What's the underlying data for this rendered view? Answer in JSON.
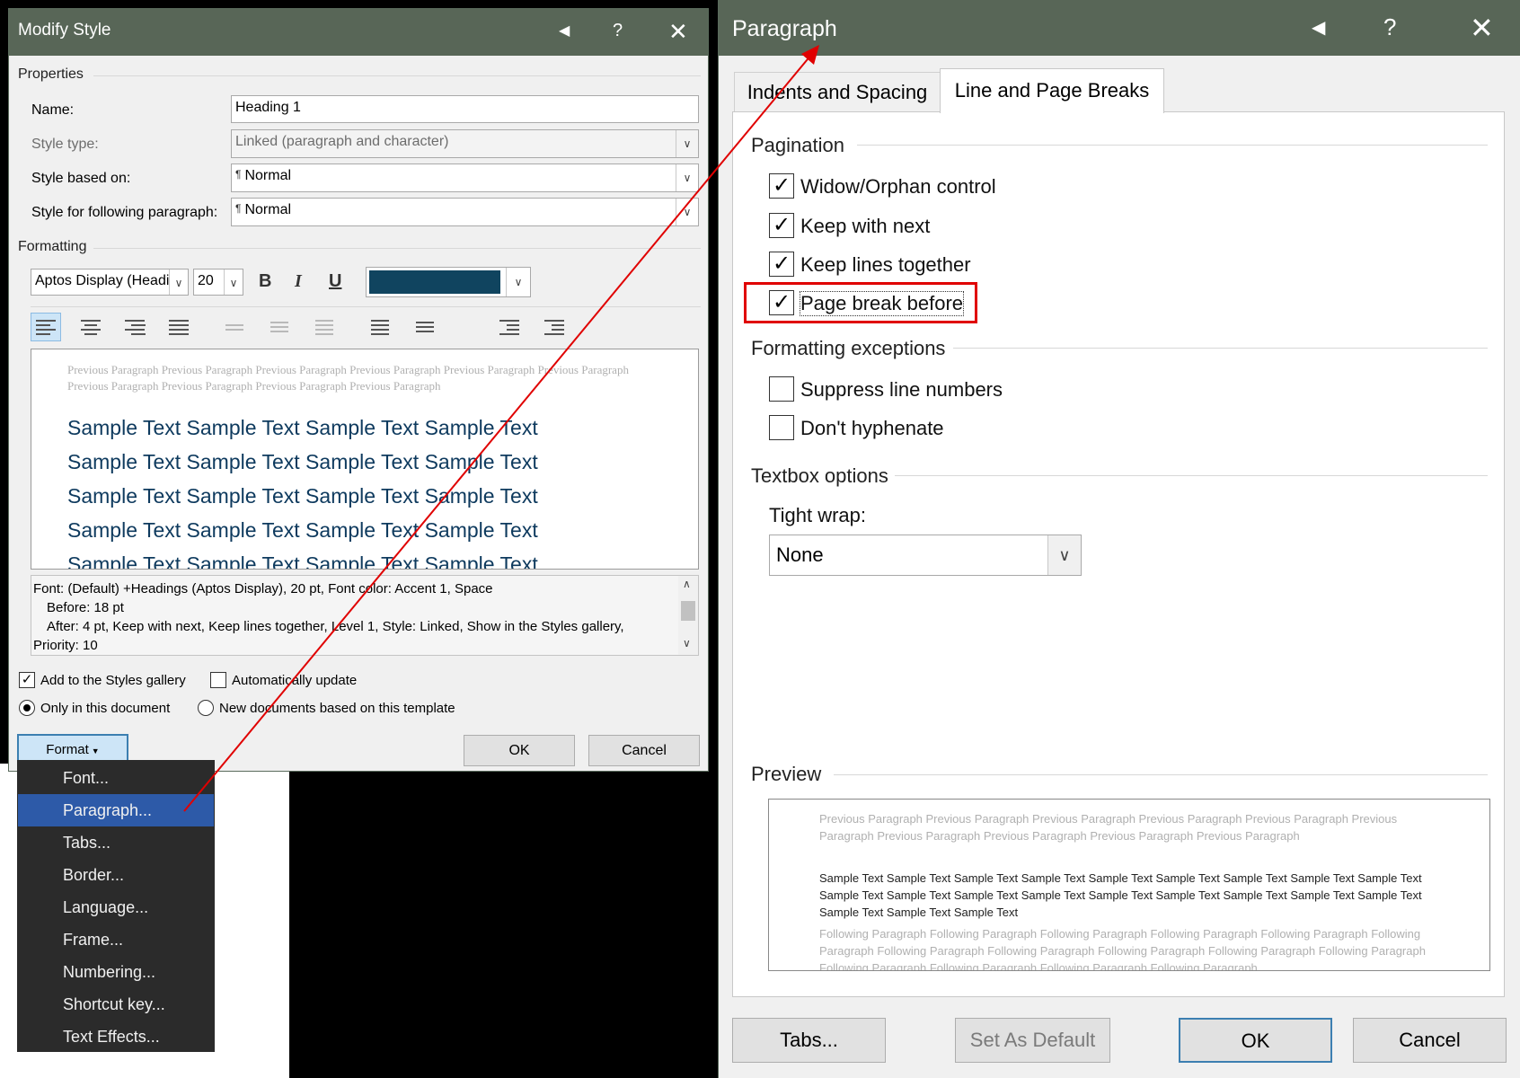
{
  "modify_style": {
    "title": "Modify Style",
    "properties_label": "Properties",
    "name_label": "Name:",
    "name_value": "Heading 1",
    "style_type_label": "Style type:",
    "style_type_value": "Linked (paragraph and character)",
    "based_on_label": "Style based on:",
    "based_on_value": "Normal",
    "following_label": "Style for following paragraph:",
    "following_value": "Normal",
    "formatting_label": "Formatting",
    "font_value": "Aptos Display (Headi",
    "size_value": "20",
    "bold": "B",
    "italic": "I",
    "underline": "U",
    "font_color": "#10445f",
    "preview_previous": "Previous Paragraph Previous Paragraph Previous Paragraph Previous Paragraph Previous Paragraph Previous Paragraph Previous Paragraph Previous Paragraph Previous Paragraph Previous Paragraph",
    "sample_lines": [
      "Sample Text Sample Text Sample Text Sample Text",
      "Sample Text Sample Text Sample Text Sample Text",
      "Sample Text Sample Text Sample Text Sample Text",
      "Sample Text Sample Text Sample Text Sample Text",
      "Sample Text Sample Text Sample Text Sample Text"
    ],
    "description_lines": [
      "Font: (Default) +Headings (Aptos Display), 20 pt, Font color: Accent 1, Space",
      "Before:  18 pt",
      "After:  4 pt, Keep with next, Keep lines together, Level 1, Style: Linked, Show in the Styles gallery,",
      "Priority: 10"
    ],
    "add_to_gallery": "Add to the Styles gallery",
    "auto_update": "Automatically update",
    "only_this_doc": "Only in this document",
    "new_docs": "New documents based on this template",
    "format_button": "Format",
    "ok": "OK",
    "cancel": "Cancel"
  },
  "format_menu": {
    "items": [
      "Font...",
      "Paragraph...",
      "Tabs...",
      "Border...",
      "Language...",
      "Frame...",
      "Numbering...",
      "Shortcut key...",
      "Text Effects..."
    ],
    "selected": "Paragraph..."
  },
  "paragraph": {
    "title": "Paragraph",
    "tabs": [
      "Indents and Spacing",
      "Line and Page Breaks"
    ],
    "active_tab": "Line and Page Breaks",
    "pagination_label": "Pagination",
    "widow_orphan": "Widow/Orphan control",
    "keep_with_next": "Keep with next",
    "keep_lines": "Keep lines together",
    "page_break": "Page break before",
    "formatting_exceptions_label": "Formatting exceptions",
    "suppress_line_numbers": "Suppress line numbers",
    "dont_hyphenate": "Don't hyphenate",
    "textbox_label": "Textbox options",
    "tight_wrap_label": "Tight wrap:",
    "tight_wrap_value": "None",
    "preview_label": "Preview",
    "preview_previous": "Previous Paragraph Previous Paragraph Previous Paragraph Previous Paragraph Previous Paragraph Previous Paragraph Previous Paragraph Previous Paragraph Previous Paragraph Previous Paragraph",
    "preview_sample": "Sample Text Sample Text Sample Text Sample Text Sample Text Sample Text Sample Text Sample Text Sample Text Sample Text Sample Text Sample Text Sample Text Sample Text Sample Text Sample Text Sample Text Sample Text Sample Text Sample Text Sample Text",
    "preview_following": "Following Paragraph Following Paragraph Following Paragraph Following Paragraph Following Paragraph Following Paragraph Following Paragraph Following Paragraph Following Paragraph Following Paragraph Following Paragraph Following Paragraph Following Paragraph Following Paragraph Following Paragraph",
    "tabs_button": "Tabs...",
    "set_default": "Set As Default",
    "ok": "OK",
    "cancel": "Cancel"
  },
  "colors": {
    "titlebar": "#586657",
    "menu_selected": "#2d5aa8",
    "annotation": "#e00000"
  }
}
